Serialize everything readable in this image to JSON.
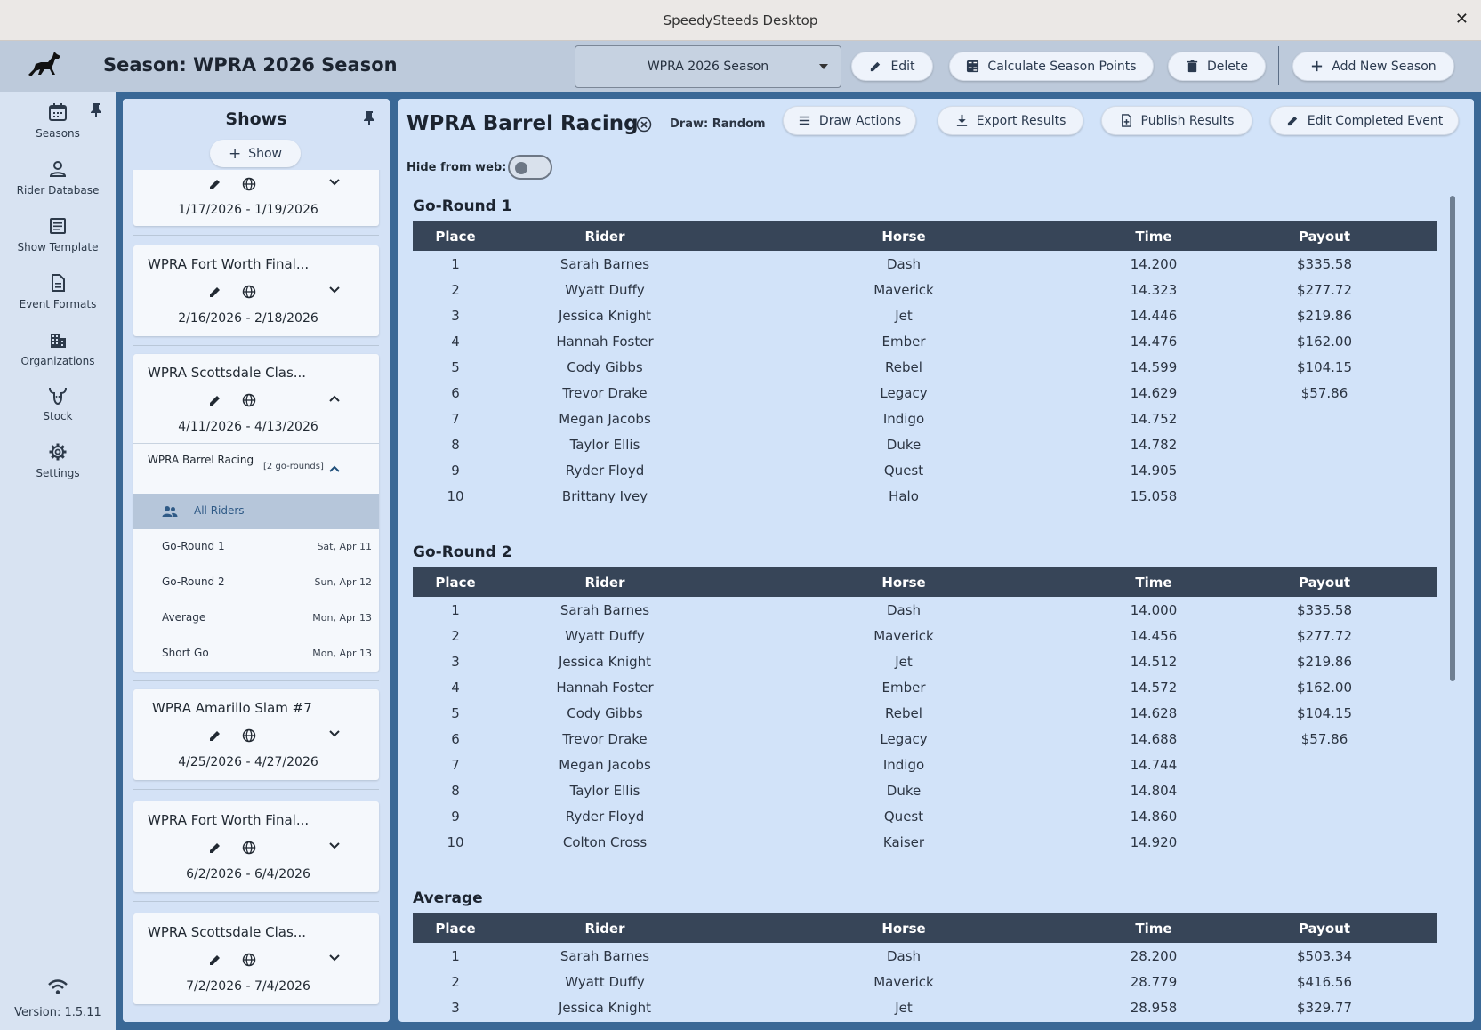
{
  "window": {
    "title": "SpeedySteeds Desktop",
    "close_glyph": "✕"
  },
  "header": {
    "title": "Season: WPRA 2026 Season",
    "season_select": "WPRA 2026 Season",
    "buttons": {
      "edit": "Edit",
      "calculate": "Calculate Season Points",
      "delete": "Delete",
      "add_season": "Add New Season"
    }
  },
  "nav": {
    "items": [
      {
        "label": "Seasons",
        "icon": "calendar-icon"
      },
      {
        "label": "Rider Database",
        "icon": "person-icon"
      },
      {
        "label": "Show Template",
        "icon": "template-icon"
      },
      {
        "label": "Event Formats",
        "icon": "document-icon"
      },
      {
        "label": "Organizations",
        "icon": "building-icon"
      },
      {
        "label": "Stock",
        "icon": "bull-icon"
      },
      {
        "label": "Settings",
        "icon": "gear-icon"
      }
    ],
    "version": "Version: 1.5.11"
  },
  "shows": {
    "title": "Shows",
    "add_label": "Show",
    "cards": [
      {
        "title": "",
        "dates": "1/17/2026 - 1/19/2026"
      },
      {
        "title": "WPRA Fort Worth Final...",
        "dates": "2/16/2026 - 2/18/2026"
      },
      {
        "title": "WPRA Scottsdale Clas...",
        "dates": "4/11/2026 - 4/13/2026"
      },
      {
        "title": "WPRA Amarillo Slam #7",
        "dates": "4/25/2026 - 4/27/2026"
      },
      {
        "title": "WPRA Fort Worth Final...",
        "dates": "6/2/2026 - 6/4/2026"
      },
      {
        "title": "WPRA Scottsdale Clas...",
        "dates": "7/2/2026 - 7/4/2026"
      }
    ],
    "expanded_event": {
      "name": "WPRA Barrel Racing",
      "count": "[2 go-rounds]",
      "items": [
        {
          "label": "All Riders",
          "date": ""
        },
        {
          "label": "Go-Round 1",
          "date": "Sat, Apr 11"
        },
        {
          "label": "Go-Round 2",
          "date": "Sun, Apr 12"
        },
        {
          "label": "Average",
          "date": "Mon, Apr 13"
        },
        {
          "label": "Short Go",
          "date": "Mon, Apr 13"
        }
      ]
    }
  },
  "event": {
    "title": "WPRA Barrel Racing",
    "draw": "Draw: Random",
    "buttons": {
      "draw_actions": "Draw Actions",
      "export": "Export Results",
      "publish": "Publish Results",
      "edit_completed": "Edit Completed Event"
    },
    "hide_from_web": "Hide from web:",
    "hide_from_web_on": false,
    "columns": [
      "Place",
      "Rider",
      "Horse",
      "Time",
      "Payout"
    ],
    "sections": [
      {
        "title": "Go-Round 1",
        "rows": [
          [
            "1",
            "Sarah Barnes",
            "Dash",
            "14.200",
            "$335.58"
          ],
          [
            "2",
            "Wyatt Duffy",
            "Maverick",
            "14.323",
            "$277.72"
          ],
          [
            "3",
            "Jessica Knight",
            "Jet",
            "14.446",
            "$219.86"
          ],
          [
            "4",
            "Hannah Foster",
            "Ember",
            "14.476",
            "$162.00"
          ],
          [
            "5",
            "Cody Gibbs",
            "Rebel",
            "14.599",
            "$104.15"
          ],
          [
            "6",
            "Trevor Drake",
            "Legacy",
            "14.629",
            "$57.86"
          ],
          [
            "7",
            "Megan Jacobs",
            "Indigo",
            "14.752",
            ""
          ],
          [
            "8",
            "Taylor Ellis",
            "Duke",
            "14.782",
            ""
          ],
          [
            "9",
            "Ryder Floyd",
            "Quest",
            "14.905",
            ""
          ],
          [
            "10",
            "Brittany Ivey",
            "Halo",
            "15.058",
            ""
          ]
        ]
      },
      {
        "title": "Go-Round 2",
        "rows": [
          [
            "1",
            "Sarah Barnes",
            "Dash",
            "14.000",
            "$335.58"
          ],
          [
            "2",
            "Wyatt Duffy",
            "Maverick",
            "14.456",
            "$277.72"
          ],
          [
            "3",
            "Jessica Knight",
            "Jet",
            "14.512",
            "$219.86"
          ],
          [
            "4",
            "Hannah Foster",
            "Ember",
            "14.572",
            "$162.00"
          ],
          [
            "5",
            "Cody Gibbs",
            "Rebel",
            "14.628",
            "$104.15"
          ],
          [
            "6",
            "Trevor Drake",
            "Legacy",
            "14.688",
            "$57.86"
          ],
          [
            "7",
            "Megan Jacobs",
            "Indigo",
            "14.744",
            ""
          ],
          [
            "8",
            "Taylor Ellis",
            "Duke",
            "14.804",
            ""
          ],
          [
            "9",
            "Ryder Floyd",
            "Quest",
            "14.860",
            ""
          ],
          [
            "10",
            "Colton Cross",
            "Kaiser",
            "14.920",
            ""
          ]
        ]
      },
      {
        "title": "Average",
        "rows": [
          [
            "1",
            "Sarah Barnes",
            "Dash",
            "28.200",
            "$503.34"
          ],
          [
            "2",
            "Wyatt Duffy",
            "Maverick",
            "28.779",
            "$416.56"
          ],
          [
            "3",
            "Jessica Knight",
            "Jet",
            "28.958",
            "$329.77"
          ]
        ]
      }
    ]
  },
  "colors": {
    "header_bg": "#bdcadb",
    "table_header": "#374558",
    "main_bg": "#d2e3f9",
    "frame": "#3a6896"
  }
}
